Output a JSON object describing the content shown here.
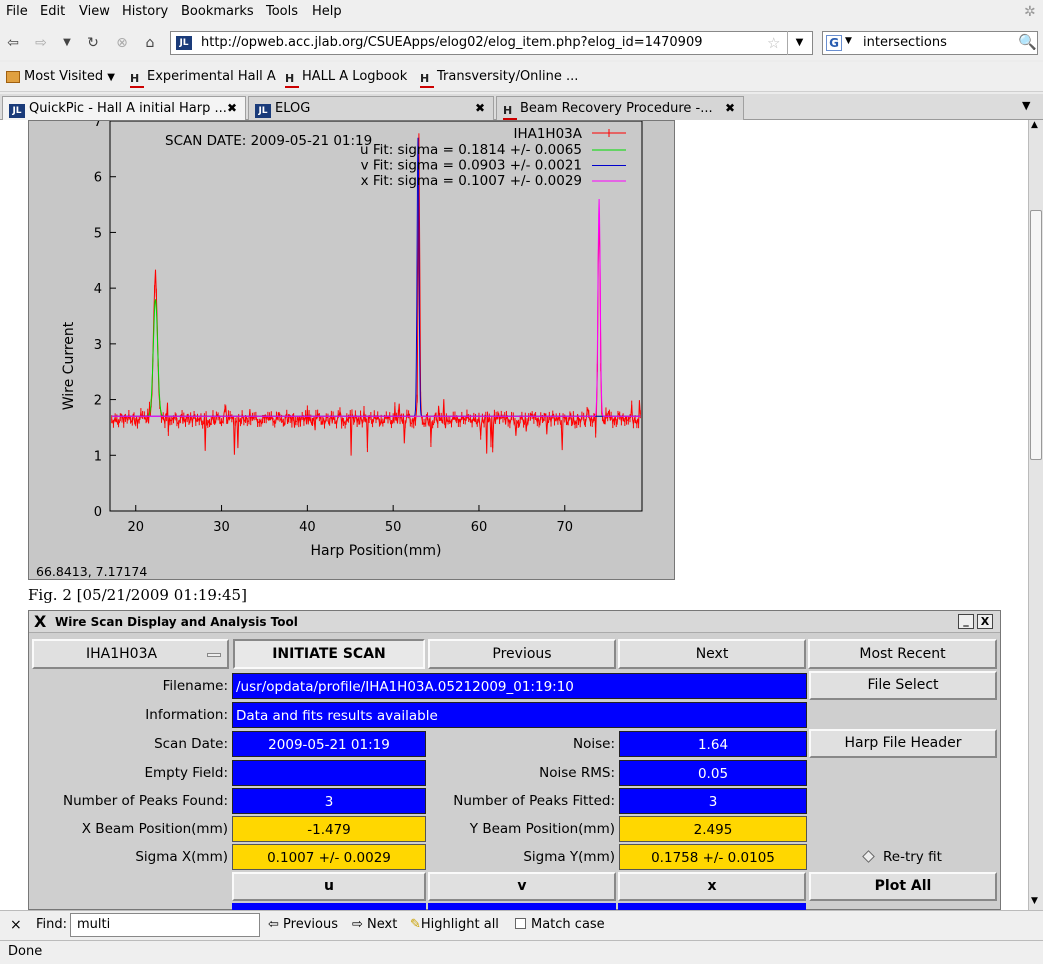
{
  "menubar": {
    "items": [
      "File",
      "Edit",
      "View",
      "History",
      "Bookmarks",
      "Tools",
      "Help"
    ]
  },
  "nav": {
    "url": "http://opweb.acc.jlab.org/CSUEApps/elog02/elog_item.php?elog_id=1470909",
    "site_icon": "JL",
    "search_engine_icon": "G",
    "search_value": "intersections"
  },
  "bookmarks": [
    {
      "label": "Most Visited",
      "icon": "folder-icon"
    },
    {
      "label": "Experimental Hall A",
      "icon": "Hall"
    },
    {
      "label": "HALL A Logbook",
      "icon": "Hall"
    },
    {
      "label": "Transversity/Online ...",
      "icon": "Hall"
    }
  ],
  "tabs": [
    {
      "label": "QuickPic - Hall A initial Harp ...",
      "icon": "JL",
      "active": true
    },
    {
      "label": "ELOG",
      "icon": "JL",
      "active": false
    },
    {
      "label": "Beam Recovery Procedure -...",
      "icon": "Hall",
      "active": false
    }
  ],
  "plot": {
    "scan_date_label": "SCAN DATE: 2009-05-21   01:19",
    "harp_name": "IHA1H03A",
    "legend": [
      {
        "letter": "u",
        "text": "Fit: sigma = 0.1814 +/- 0.0065",
        "color": "#00dd00"
      },
      {
        "letter": "v",
        "text": "Fit: sigma = 0.0903 +/- 0.0021",
        "color": "#0000cc"
      },
      {
        "letter": "x",
        "text": "Fit: sigma = 0.1007 +/- 0.0029",
        "color": "#ff00ff"
      }
    ],
    "cursor_readout": "66.8413,  7.17174"
  },
  "chart_data": {
    "type": "line",
    "xlabel": "Harp Position(mm)",
    "ylabel": "Wire Current",
    "xlim": [
      17,
      79
    ],
    "ylim": [
      0,
      7
    ],
    "x_ticks": [
      20,
      30,
      40,
      50,
      60,
      70
    ],
    "y_ticks": [
      0,
      1,
      2,
      3,
      4,
      5,
      6,
      7
    ],
    "grid": true,
    "legend_position": "top-right",
    "series": [
      {
        "name": "IHA1H03A",
        "color": "#ff0000",
        "baseline": 1.65,
        "peaks": [
          [
            22.3,
            4.25
          ],
          [
            53.0,
            6.8
          ],
          [
            74.0,
            5.65
          ]
        ]
      },
      {
        "name": "u",
        "color": "#00dd00",
        "center": 22.3,
        "amplitude": 3.8,
        "baseline": 1.7
      },
      {
        "name": "v",
        "color": "#0000cc",
        "center": 52.9,
        "amplitude": 6.7,
        "baseline": 1.7
      },
      {
        "name": "x",
        "color": "#ff00ff",
        "center": 74.0,
        "amplitude": 5.6,
        "baseline": 1.7
      }
    ]
  },
  "figure_caption": "Fig. 2 [05/21/2009 01:19:45]",
  "tool": {
    "title": "Wire Scan Display and Analysis Tool",
    "title_icon": "X",
    "minimize": "_",
    "close": "X",
    "harp_select": "IHA1H03A",
    "buttons": {
      "initiate": "INITIATE SCAN",
      "previous": "Previous",
      "next": "Next",
      "most_recent": "Most Recent",
      "file_select": "File Select",
      "harp_header": "Harp File Header",
      "plot_all": "Plot All",
      "u": "u",
      "v": "v",
      "x": "x"
    },
    "filename_label": "Filename:",
    "filename": "/usr/opdata/profile/IHA1H03A.05212009_01:19:10",
    "information_label": "Information:",
    "information": "Data and fits results available",
    "scan_date_label": "Scan Date:",
    "scan_date": "2009-05-21   01:19",
    "noise_label": "Noise:",
    "noise": "1.64",
    "empty_label": "Empty Field:",
    "empty_value": "",
    "noise_rms_label": "Noise RMS:",
    "noise_rms": "0.05",
    "peaks_found_label": "Number of Peaks Found:",
    "peaks_found": "3",
    "peaks_fitted_label": "Number of Peaks Fitted:",
    "peaks_fitted": "3",
    "xbeam_label": "X Beam Position(mm)",
    "xbeam": "-1.479",
    "ybeam_label": "Y Beam Position(mm)",
    "ybeam": "2.495",
    "sigmax_label": "Sigma X(mm)",
    "sigmax": "0.1007 +/- 0.0029",
    "sigmay_label": "Sigma Y(mm)",
    "sigmay": "0.1758 +/- 0.0105",
    "retry_label": "Re-try fit"
  },
  "findbar": {
    "close": "×",
    "label": "Find:",
    "value": "multi",
    "previous": "Previous",
    "next": "Next",
    "highlight": "Highlight all",
    "match_case": "Match case"
  },
  "status": "Done"
}
